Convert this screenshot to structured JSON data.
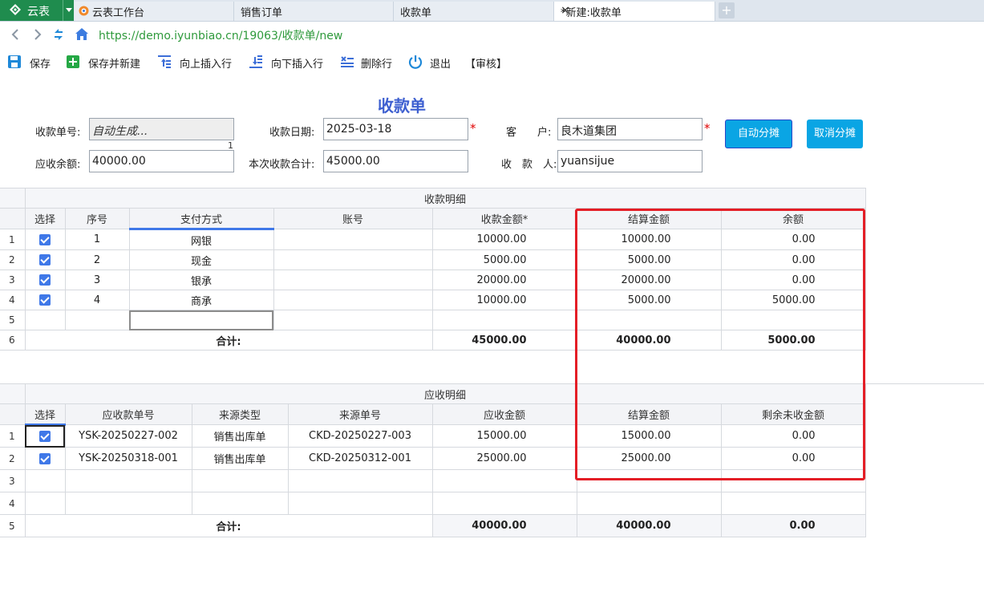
{
  "tabs": {
    "logo_label": "云表",
    "items": [
      {
        "label": "云表工作台"
      },
      {
        "label": "销售订单"
      },
      {
        "label": "收款单"
      },
      {
        "label": "*新建:收款单"
      }
    ],
    "close_glyph": "×",
    "new_tab_glyph": "+"
  },
  "address": {
    "url": "https://demo.iyunbiao.cn/19063/收款单/new"
  },
  "toolbar": {
    "save": "保存",
    "save_new": "保存并新建",
    "insert_above": "向上插入行",
    "insert_below": "向下插入行",
    "delete_row": "删除行",
    "exit": "退出",
    "audit": "【审核】"
  },
  "form": {
    "title": "收款单",
    "order_no_label": "收款单号:",
    "order_no_value": "自动生成...",
    "order_no_suffix": "1",
    "date_label": "收款日期:",
    "date_value": "2025-03-18",
    "customer_label": "客　　户:",
    "customer_value": "良木道集团",
    "receivable_label": "应收余额:",
    "receivable_value": "40000.00",
    "total_label": "本次收款合计:",
    "total_value": "45000.00",
    "payee_label": "收　款　人:",
    "payee_value": "yuansijue",
    "required_mark": "*",
    "auto_alloc": "自动分摊",
    "cancel_alloc": "取消分摊"
  },
  "payment_grid": {
    "caption": "收款明细",
    "headers": [
      "选择",
      "序号",
      "支付方式",
      "账号",
      "收款金额*",
      "结算金额",
      "余额"
    ],
    "rows": [
      {
        "n": "1",
        "seq": "1",
        "method": "网银",
        "account": "",
        "amount": "10000.00",
        "settle": "10000.00",
        "balance": "0.00"
      },
      {
        "n": "2",
        "seq": "2",
        "method": "现金",
        "account": "",
        "amount": "5000.00",
        "settle": "5000.00",
        "balance": "0.00"
      },
      {
        "n": "3",
        "seq": "3",
        "method": "银承",
        "account": "",
        "amount": "20000.00",
        "settle": "20000.00",
        "balance": "0.00"
      },
      {
        "n": "4",
        "seq": "4",
        "method": "商承",
        "account": "",
        "amount": "10000.00",
        "settle": "5000.00",
        "balance": "5000.00"
      }
    ],
    "empty_row_n": "5",
    "total_row_n": "6",
    "total_label": "合计:",
    "total_amount": "45000.00",
    "total_settle": "40000.00",
    "total_balance": "5000.00"
  },
  "receivable_grid": {
    "caption": "应收明细",
    "headers": [
      "选择",
      "应收款单号",
      "来源类型",
      "来源单号",
      "应收金额",
      "结算金额",
      "剩余未收金额"
    ],
    "rows": [
      {
        "n": "1",
        "no": "YSK-20250227-002",
        "type": "销售出库单",
        "src": "CKD-20250227-003",
        "amount": "15000.00",
        "settle": "15000.00",
        "remain": "0.00"
      },
      {
        "n": "2",
        "no": "YSK-20250318-001",
        "type": "销售出库单",
        "src": "CKD-20250312-001",
        "amount": "25000.00",
        "settle": "25000.00",
        "remain": "0.00"
      }
    ],
    "empty_rows_n": [
      "3",
      "4"
    ],
    "total_row_n": "5",
    "total_label": "合计:",
    "total_amount": "40000.00",
    "total_settle": "40000.00",
    "total_remain": "0.00"
  },
  "colors": {
    "accent": "#3f78e8",
    "title": "#3d5fd0",
    "highlight_box": "#e41e26",
    "button": "#0aa5e4",
    "logo_bg": "#1f8c4e"
  }
}
